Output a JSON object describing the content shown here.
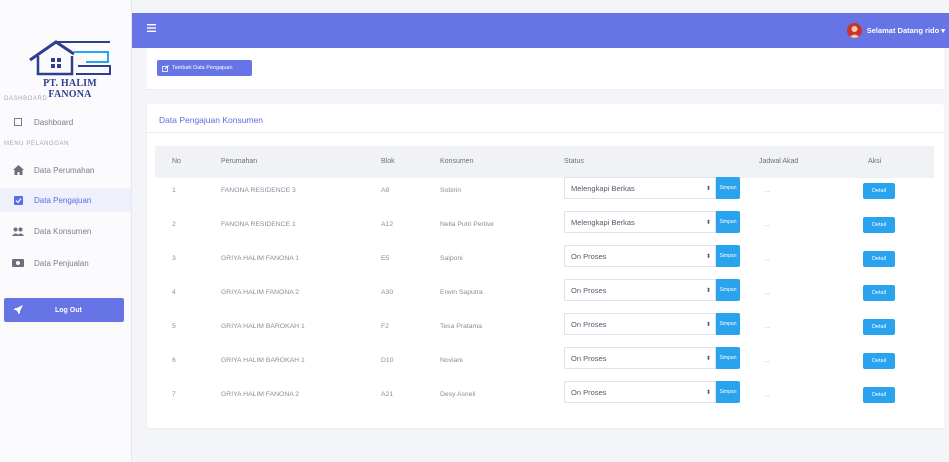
{
  "brand": {
    "name": "PT. HALIM FANONA"
  },
  "sidebar": {
    "sections": [
      {
        "label": "DASHBOARD",
        "items": [
          {
            "label": "Dashboard",
            "icon": "square-icon"
          }
        ]
      },
      {
        "label": "MENU PELANGGAN",
        "items": [
          {
            "label": "Data Perumahan",
            "icon": "home-icon"
          },
          {
            "label": "Data Pengajuan",
            "icon": "check-square-icon",
            "active": true
          },
          {
            "label": "Data Konsumen",
            "icon": "users-icon"
          },
          {
            "label": "Data Penjualan",
            "icon": "money-icon"
          }
        ]
      }
    ],
    "logout": {
      "label": "Log Out",
      "icon": "rocket-icon"
    }
  },
  "topbar": {
    "user_greeting": "Selamat Datang rido",
    "caret": "▾"
  },
  "toolbar": {
    "add_label": "Tambah Data Pengajuan"
  },
  "card": {
    "title": "Data Pengajuan Konsumen"
  },
  "table": {
    "headers": [
      "No",
      "Perumahan",
      "Blok",
      "Konsumen",
      "Status",
      "Jadwal Akad",
      "Aksi"
    ],
    "rows": [
      {
        "no": "1",
        "perumahan": "FANONA RESIDENCE 3",
        "blok": "A8",
        "konsumen": "Sobirin",
        "status": "Melengkapi Berkas",
        "jadwal": "--"
      },
      {
        "no": "2",
        "perumahan": "FANONA RESIDENCE 1",
        "blok": "A12",
        "konsumen": "Nella Putri Pertiwi",
        "status": "Melengkapi Berkas",
        "jadwal": "--"
      },
      {
        "no": "3",
        "perumahan": "GRIYA HALIM FANONA 1",
        "blok": "E5",
        "konsumen": "Salponi",
        "status": "On Proses",
        "jadwal": "--"
      },
      {
        "no": "4",
        "perumahan": "GRIYA HALIM FANONA 2",
        "blok": "A30",
        "konsumen": "Erwin Saputra",
        "status": "On Proses",
        "jadwal": "--"
      },
      {
        "no": "5",
        "perumahan": "GRIYA HALIM BAROKAH 1",
        "blok": "F2",
        "konsumen": "Tesa Pratama",
        "status": "On Proses",
        "jadwal": "--"
      },
      {
        "no": "6",
        "perumahan": "GRIYA HALIM BAROKAH 1",
        "blok": "D10",
        "konsumen": "Noviani",
        "status": "On Proses",
        "jadwal": "--"
      },
      {
        "no": "7",
        "perumahan": "GRIYA HALIM FANONA 2",
        "blok": "A21",
        "konsumen": "Desy Asneli",
        "status": "On Proses",
        "jadwal": "--"
      }
    ],
    "simpan_label": "Simpan",
    "detail_label": "Detail",
    "select_arrow": "⬍"
  },
  "colors": {
    "primary": "#6674e6",
    "info": "#2aa3ee",
    "avatar": "#c8342b"
  }
}
